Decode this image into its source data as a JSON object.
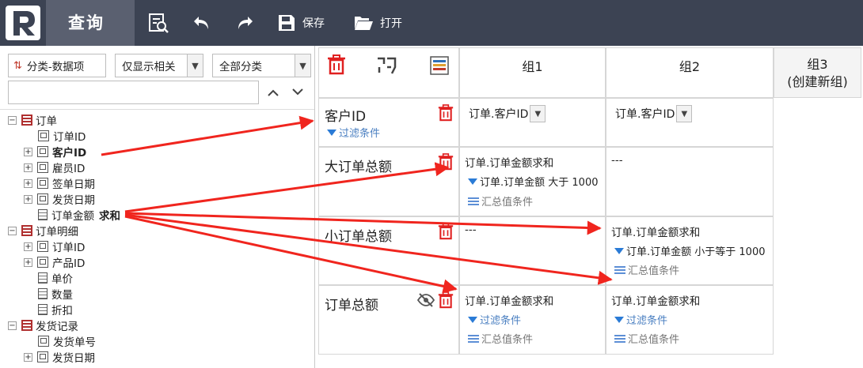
{
  "topbar": {
    "logo_letter": "R",
    "title": "查询",
    "save_label": "保存",
    "open_label": "打开"
  },
  "left_panel": {
    "category_button": "分类-数据项",
    "filter_select": "仅显示相关",
    "category_select": "全部分类",
    "search_value": "",
    "tree": [
      {
        "label": "订单",
        "type": "table",
        "expander": "−"
      },
      {
        "label": "订单ID",
        "type": "field"
      },
      {
        "label": "客户ID",
        "type": "field",
        "expander": "+"
      },
      {
        "label": "雇员ID",
        "type": "field",
        "expander": "+"
      },
      {
        "label": "签单日期",
        "type": "field",
        "expander": "+"
      },
      {
        "label": "发货日期",
        "type": "field",
        "expander": "+"
      },
      {
        "label": "订单金额",
        "type": "num",
        "suffix": "求和"
      },
      {
        "label": "订单明细",
        "type": "table",
        "expander": "−"
      },
      {
        "label": "订单ID",
        "type": "field",
        "expander": "+"
      },
      {
        "label": "产品ID",
        "type": "field",
        "expander": "+"
      },
      {
        "label": "单价",
        "type": "num"
      },
      {
        "label": "数量",
        "type": "num"
      },
      {
        "label": "折扣",
        "type": "num"
      },
      {
        "label": "发货记录",
        "type": "table",
        "expander": "−"
      },
      {
        "label": "发货单号",
        "type": "field"
      },
      {
        "label": "发货日期",
        "type": "field",
        "expander": "+"
      }
    ]
  },
  "grid": {
    "headers": {
      "group1": "组1",
      "group2": "组2",
      "group3_line1": "组3",
      "group3_line2": "(创建新组)"
    },
    "rows": {
      "customer": {
        "label": "客户ID",
        "filter": "过滤条件",
        "g1_field": "订单.客户ID",
        "g2_field": "订单.客户ID"
      },
      "big": {
        "label": "大订单总额",
        "g1_measure": "订单.订单金额求和",
        "g1_filter": "订单.订单金额 大于 1000",
        "g1_summary": "汇总值条件",
        "g2_empty": "---"
      },
      "small": {
        "label": "小订单总额",
        "g1_empty": "---",
        "g2_measure": "订单.订单金额求和",
        "g2_filter": "订单.订单金额 小于等于 1000",
        "g2_summary": "汇总值条件"
      },
      "total": {
        "label": "订单总额",
        "g1_measure": "订单.订单金额求和",
        "g1_filter": "过滤条件",
        "g1_summary": "汇总值条件",
        "g2_measure": "订单.订单金额求和",
        "g2_filter": "过滤条件",
        "g2_summary": "汇总值条件"
      }
    }
  },
  "colors": {
    "topbar": "#3c4353",
    "title_tab": "#5a6070",
    "arrow": "#f0251e",
    "trash": "#e02020",
    "filter_icon": "#2a7bd6"
  }
}
